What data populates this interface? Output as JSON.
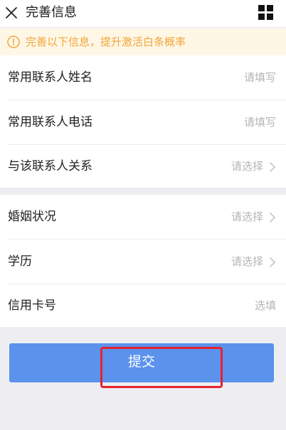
{
  "header": {
    "title": "完善信息",
    "close_icon": "close-icon",
    "menu_icon": "grid-icon"
  },
  "notice": {
    "text": "完善以下信息，提升激活白条概率",
    "icon": "info-icon",
    "color": "#f0a63a"
  },
  "groups": [
    {
      "rows": [
        {
          "label": "常用联系人姓名",
          "value": "请填写",
          "type": "input"
        },
        {
          "label": "常用联系人电话",
          "value": "请填写",
          "type": "input"
        },
        {
          "label": "与该联系人关系",
          "value": "请选择",
          "type": "select"
        }
      ]
    },
    {
      "rows": [
        {
          "label": "婚姻状况",
          "value": "请选择",
          "type": "select"
        },
        {
          "label": "学历",
          "value": "请选择",
          "type": "select"
        },
        {
          "label": "信用卡号",
          "value": "选填",
          "type": "input"
        }
      ]
    }
  ],
  "submit": {
    "label": "提交",
    "color": "#5a92ec"
  },
  "annotation": {
    "color": "#e8212c"
  }
}
